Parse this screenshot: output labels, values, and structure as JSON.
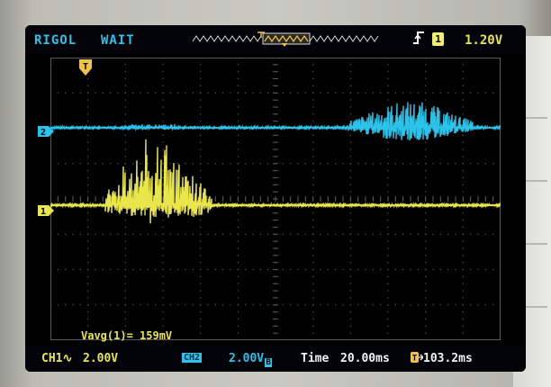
{
  "header": {
    "brand": "RIGOL",
    "status": "WAIT",
    "trigger_edge_icon": "rising-edge-icon",
    "trigger_source": "1",
    "trigger_level": "1.20V"
  },
  "markers": {
    "trigger_marker": "T",
    "ch1_marker": "1",
    "ch2_marker": "2"
  },
  "measurement": {
    "label": "Vavg(1)= 159mV"
  },
  "footer": {
    "ch1_label": "CH1∿",
    "ch1_scale": "2.00V",
    "ch2_label": "CH2",
    "ch2_scale": "2.00V",
    "ch2_bw": "B",
    "time_label": "Time",
    "time_scale": "20.00ms",
    "offset_icon": "trigger-offset-icon",
    "offset_value": "103.2ms"
  },
  "colors": {
    "ch1": "#e9e64b",
    "ch2": "#2bc3ea",
    "grid": "#5a5a5a",
    "background": "#000000"
  }
}
